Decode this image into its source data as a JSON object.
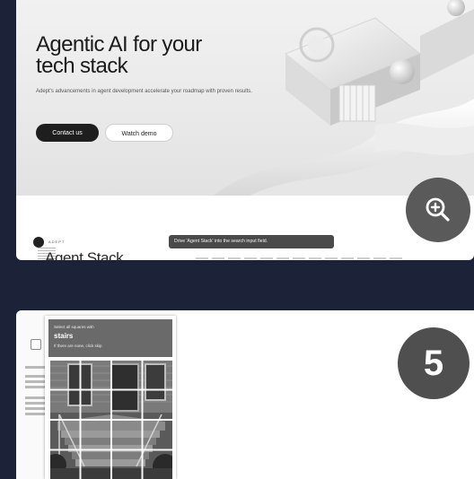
{
  "hero": {
    "title": "Agentic AI for your tech stack",
    "subtitle": "Adept's advancements in agent development accelerate your roadmap with proven results.",
    "primary_button": "Contact us",
    "secondary_button": "Watch demo"
  },
  "product": {
    "brand": "ADEPT",
    "title": "Agent Stack"
  },
  "tooltip": {
    "text": "Drive 'Agent Stack' into the search input field."
  },
  "zoom": {
    "icon": "zoom-in-icon"
  },
  "captcha": {
    "instruction": "Select all squares with",
    "target": "stairs",
    "hint": "If there are none, click skip"
  },
  "step": {
    "number": "5"
  },
  "colors": {
    "background": "#1c2238",
    "badge": "#4f4f4f",
    "primary_button": "#1e1e1e"
  }
}
